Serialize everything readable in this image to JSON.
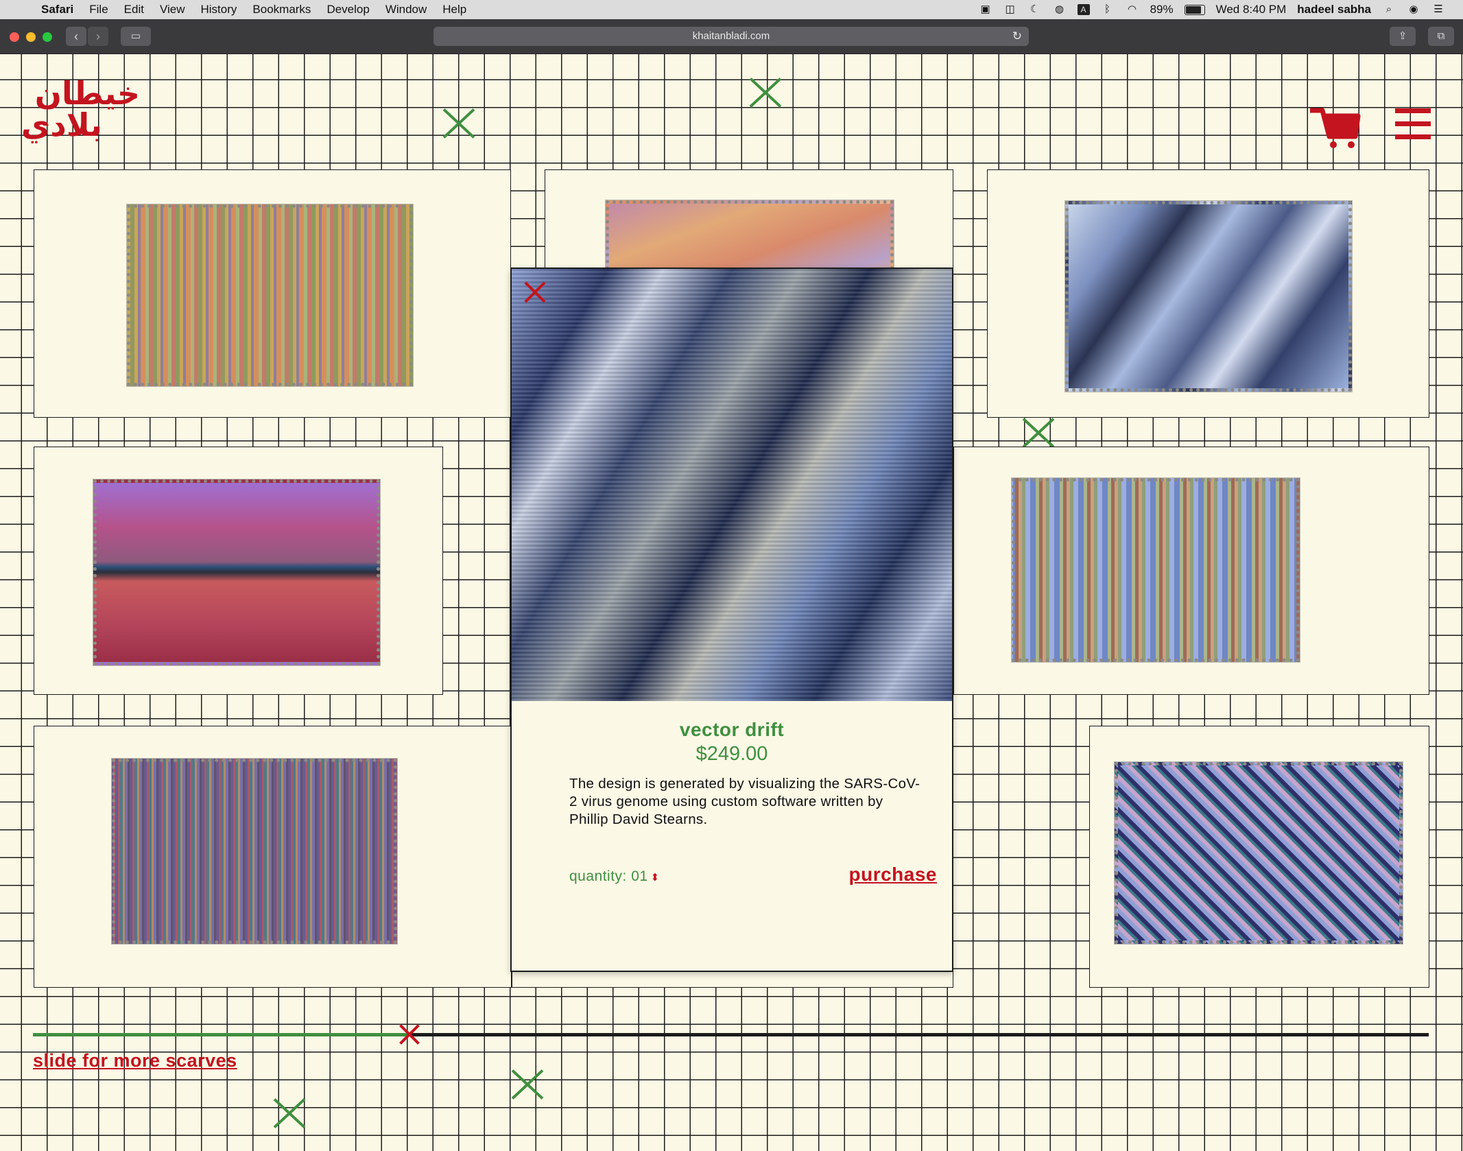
{
  "menubar": {
    "items": [
      "Safari",
      "File",
      "Edit",
      "View",
      "History",
      "Bookmarks",
      "Develop",
      "Window",
      "Help"
    ],
    "battery": "89%",
    "clock": "Wed 8:40 PM",
    "user": "hadeel sabha"
  },
  "browser": {
    "url": "khaitanbladi.com"
  },
  "brand": {
    "logo_line1": "خيطان",
    "logo_line2": "بلادي",
    "accent": "#c3141f",
    "green": "#3f8f3f",
    "background": "#fbf8e6"
  },
  "product": {
    "title": "vector drift",
    "price": "$249.00",
    "description": "The design is generated by visualizing the SARS-CoV-2 virus genome using custom software written by Phillip David Stearns.",
    "quantity_label": "quantity: 01",
    "purchase_label": "purchase"
  },
  "footer": {
    "slider_label": "slide for more scarves",
    "slider_progress": 0.27
  }
}
